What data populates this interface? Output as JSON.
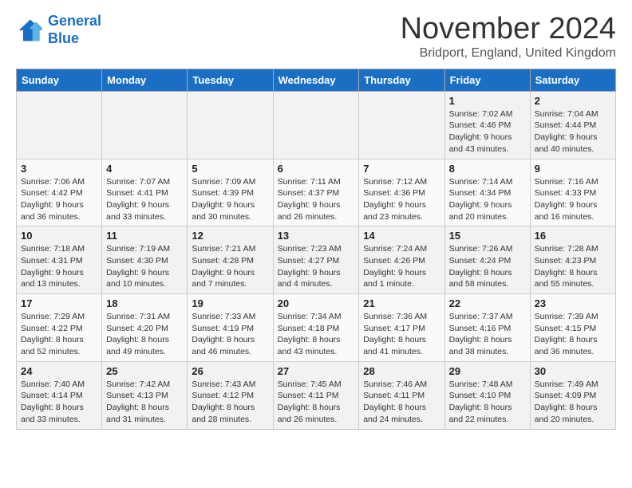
{
  "logo": {
    "line1": "General",
    "line2": "Blue"
  },
  "title": "November 2024",
  "subtitle": "Bridport, England, United Kingdom",
  "headers": [
    "Sunday",
    "Monday",
    "Tuesday",
    "Wednesday",
    "Thursday",
    "Friday",
    "Saturday"
  ],
  "weeks": [
    [
      {
        "day": "",
        "info": ""
      },
      {
        "day": "",
        "info": ""
      },
      {
        "day": "",
        "info": ""
      },
      {
        "day": "",
        "info": ""
      },
      {
        "day": "",
        "info": ""
      },
      {
        "day": "1",
        "info": "Sunrise: 7:02 AM\nSunset: 4:46 PM\nDaylight: 9 hours\nand 43 minutes."
      },
      {
        "day": "2",
        "info": "Sunrise: 7:04 AM\nSunset: 4:44 PM\nDaylight: 9 hours\nand 40 minutes."
      }
    ],
    [
      {
        "day": "3",
        "info": "Sunrise: 7:06 AM\nSunset: 4:42 PM\nDaylight: 9 hours\nand 36 minutes."
      },
      {
        "day": "4",
        "info": "Sunrise: 7:07 AM\nSunset: 4:41 PM\nDaylight: 9 hours\nand 33 minutes."
      },
      {
        "day": "5",
        "info": "Sunrise: 7:09 AM\nSunset: 4:39 PM\nDaylight: 9 hours\nand 30 minutes."
      },
      {
        "day": "6",
        "info": "Sunrise: 7:11 AM\nSunset: 4:37 PM\nDaylight: 9 hours\nand 26 minutes."
      },
      {
        "day": "7",
        "info": "Sunrise: 7:12 AM\nSunset: 4:36 PM\nDaylight: 9 hours\nand 23 minutes."
      },
      {
        "day": "8",
        "info": "Sunrise: 7:14 AM\nSunset: 4:34 PM\nDaylight: 9 hours\nand 20 minutes."
      },
      {
        "day": "9",
        "info": "Sunrise: 7:16 AM\nSunset: 4:33 PM\nDaylight: 9 hours\nand 16 minutes."
      }
    ],
    [
      {
        "day": "10",
        "info": "Sunrise: 7:18 AM\nSunset: 4:31 PM\nDaylight: 9 hours\nand 13 minutes."
      },
      {
        "day": "11",
        "info": "Sunrise: 7:19 AM\nSunset: 4:30 PM\nDaylight: 9 hours\nand 10 minutes."
      },
      {
        "day": "12",
        "info": "Sunrise: 7:21 AM\nSunset: 4:28 PM\nDaylight: 9 hours\nand 7 minutes."
      },
      {
        "day": "13",
        "info": "Sunrise: 7:23 AM\nSunset: 4:27 PM\nDaylight: 9 hours\nand 4 minutes."
      },
      {
        "day": "14",
        "info": "Sunrise: 7:24 AM\nSunset: 4:26 PM\nDaylight: 9 hours\nand 1 minute."
      },
      {
        "day": "15",
        "info": "Sunrise: 7:26 AM\nSunset: 4:24 PM\nDaylight: 8 hours\nand 58 minutes."
      },
      {
        "day": "16",
        "info": "Sunrise: 7:28 AM\nSunset: 4:23 PM\nDaylight: 8 hours\nand 55 minutes."
      }
    ],
    [
      {
        "day": "17",
        "info": "Sunrise: 7:29 AM\nSunset: 4:22 PM\nDaylight: 8 hours\nand 52 minutes."
      },
      {
        "day": "18",
        "info": "Sunrise: 7:31 AM\nSunset: 4:20 PM\nDaylight: 8 hours\nand 49 minutes."
      },
      {
        "day": "19",
        "info": "Sunrise: 7:33 AM\nSunset: 4:19 PM\nDaylight: 8 hours\nand 46 minutes."
      },
      {
        "day": "20",
        "info": "Sunrise: 7:34 AM\nSunset: 4:18 PM\nDaylight: 8 hours\nand 43 minutes."
      },
      {
        "day": "21",
        "info": "Sunrise: 7:36 AM\nSunset: 4:17 PM\nDaylight: 8 hours\nand 41 minutes."
      },
      {
        "day": "22",
        "info": "Sunrise: 7:37 AM\nSunset: 4:16 PM\nDaylight: 8 hours\nand 38 minutes."
      },
      {
        "day": "23",
        "info": "Sunrise: 7:39 AM\nSunset: 4:15 PM\nDaylight: 8 hours\nand 36 minutes."
      }
    ],
    [
      {
        "day": "24",
        "info": "Sunrise: 7:40 AM\nSunset: 4:14 PM\nDaylight: 8 hours\nand 33 minutes."
      },
      {
        "day": "25",
        "info": "Sunrise: 7:42 AM\nSunset: 4:13 PM\nDaylight: 8 hours\nand 31 minutes."
      },
      {
        "day": "26",
        "info": "Sunrise: 7:43 AM\nSunset: 4:12 PM\nDaylight: 8 hours\nand 28 minutes."
      },
      {
        "day": "27",
        "info": "Sunrise: 7:45 AM\nSunset: 4:11 PM\nDaylight: 8 hours\nand 26 minutes."
      },
      {
        "day": "28",
        "info": "Sunrise: 7:46 AM\nSunset: 4:11 PM\nDaylight: 8 hours\nand 24 minutes."
      },
      {
        "day": "29",
        "info": "Sunrise: 7:48 AM\nSunset: 4:10 PM\nDaylight: 8 hours\nand 22 minutes."
      },
      {
        "day": "30",
        "info": "Sunrise: 7:49 AM\nSunset: 4:09 PM\nDaylight: 8 hours\nand 20 minutes."
      }
    ]
  ]
}
